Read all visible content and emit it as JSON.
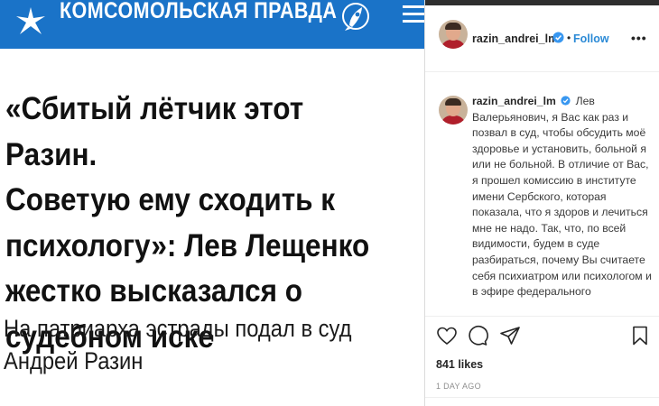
{
  "article": {
    "brand": "КОМСОМОЛЬСКАЯ ПРАВДА",
    "headline_lines": [
      "«Сбитый лётчик этот Разин.",
      "Советую ему сходить к",
      "психологу»: Лев Лещенко",
      "жестко высказался о",
      "судебном иске"
    ],
    "sub_lines": [
      "На патриарха эстрады подал в суд",
      "Андрей Разин"
    ],
    "colors": {
      "header_bg": "#1a73c8",
      "text": "#111111"
    },
    "icons": [
      "star-logo-icon",
      "rocket-icon",
      "menu-icon"
    ]
  },
  "post": {
    "username": "razin_andrei_lm",
    "separator": "•",
    "follow_label": "Follow",
    "more_label": "•••",
    "comment": {
      "username": "razin_andrei_lm",
      "text": "Лев Валерьянович, я Вас как раз и позвал в суд, чтобы обсудить моё здоровье и установить, больной я или не больной. В отличие от Вас, я прошел комиссию в институте имени Сербского, которая показала, что я здоров и лечиться мне не надо. Так, что, по всей видимости, будем в суде разбираться, почему Вы считаете себя психиатром или психологом и в эфире федерального"
    },
    "likes": "841 likes",
    "time": "1 DAY AGO",
    "colors": {
      "follow": "#2b8ad6",
      "verified": "#3897f0",
      "muted": "#8e8e8e"
    },
    "icons": [
      "heart-icon",
      "comment-icon",
      "share-icon",
      "save-icon",
      "verified-icon"
    ]
  }
}
